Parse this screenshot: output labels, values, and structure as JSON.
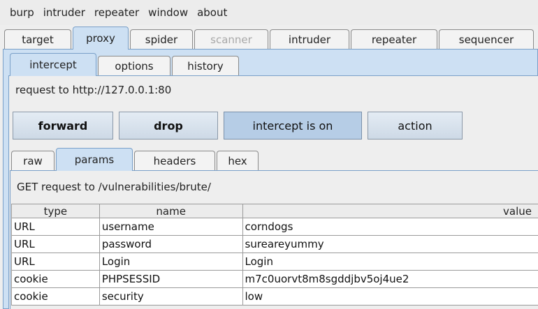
{
  "menubar": [
    "burp",
    "intruder",
    "repeater",
    "window",
    "about"
  ],
  "main_tabs": [
    {
      "label": "target",
      "state": "normal"
    },
    {
      "label": "proxy",
      "state": "active"
    },
    {
      "label": "spider",
      "state": "normal"
    },
    {
      "label": "scanner",
      "state": "disabled"
    },
    {
      "label": "intruder",
      "state": "normal"
    },
    {
      "label": "repeater",
      "state": "normal"
    },
    {
      "label": "sequencer",
      "state": "normal"
    }
  ],
  "proxy_tabs": [
    {
      "label": "intercept",
      "state": "active"
    },
    {
      "label": "options",
      "state": "normal"
    },
    {
      "label": "history",
      "state": "normal"
    }
  ],
  "intercept": {
    "request_to": "request to http://127.0.0.1:80",
    "buttons": {
      "forward": "forward",
      "drop": "drop",
      "intercept_toggle": "intercept is on",
      "action": "action"
    }
  },
  "message_tabs": [
    {
      "label": "raw",
      "state": "normal"
    },
    {
      "label": "params",
      "state": "active"
    },
    {
      "label": "headers",
      "state": "normal"
    },
    {
      "label": "hex",
      "state": "normal"
    }
  ],
  "params": {
    "request_line": "GET request to /vulnerabilities/brute/",
    "columns": [
      "type",
      "name",
      "value"
    ],
    "rows": [
      {
        "type": "URL",
        "name": "username",
        "value": "corndogs"
      },
      {
        "type": "URL",
        "name": "password",
        "value": "sureareyummy"
      },
      {
        "type": "URL",
        "name": "Login",
        "value": "Login"
      },
      {
        "type": "cookie",
        "name": "PHPSESSID",
        "value": "m7c0uorvt8m8sgddjbv5oj4ue2"
      },
      {
        "type": "cookie",
        "name": "security",
        "value": "low"
      }
    ]
  },
  "colors": {
    "active_tab": "#cde0f3",
    "border_blue": "#7aa0c8",
    "toggled_button": "#b6cde6"
  }
}
